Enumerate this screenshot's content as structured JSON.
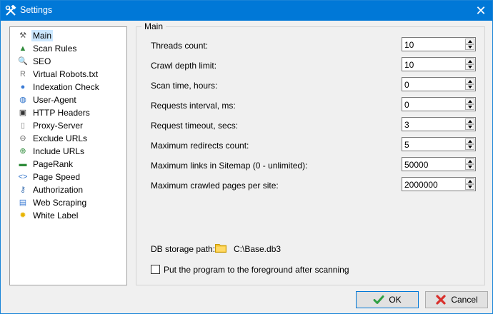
{
  "window": {
    "title": "Settings",
    "close_glyph": "✕"
  },
  "sidebar": {
    "items": [
      {
        "label": "Main",
        "icon": "tools-icon",
        "glyph": "⚒",
        "color": "#555555"
      },
      {
        "label": "Scan Rules",
        "icon": "scan-rules-icon",
        "glyph": "▲",
        "color": "#2e8b3a"
      },
      {
        "label": "SEO",
        "icon": "seo-magnifier-icon",
        "glyph": "🔍",
        "color": "#1a5fb4"
      },
      {
        "label": "Virtual Robots.txt",
        "icon": "robots-file-icon",
        "glyph": "R",
        "color": "#777777"
      },
      {
        "label": "Indexation Check",
        "icon": "indexation-icon",
        "glyph": "●",
        "color": "#3a7bd5"
      },
      {
        "label": "User-Agent",
        "icon": "globe-icon",
        "glyph": "◍",
        "color": "#2a6fc9"
      },
      {
        "label": "HTTP Headers",
        "icon": "monitor-icon",
        "glyph": "▣",
        "color": "#333333"
      },
      {
        "label": "Proxy-Server",
        "icon": "proxy-icon",
        "glyph": "▯",
        "color": "#888888"
      },
      {
        "label": "Exclude URLs",
        "icon": "exclude-link-icon",
        "glyph": "⊖",
        "color": "#666666"
      },
      {
        "label": "Include URLs",
        "icon": "include-link-icon",
        "glyph": "⊕",
        "color": "#2e8b3a"
      },
      {
        "label": "PageRank",
        "icon": "pagerank-icon",
        "glyph": "▬",
        "color": "#2e8b3a"
      },
      {
        "label": "Page Speed",
        "icon": "code-icon",
        "glyph": "<>",
        "color": "#2a6fc9"
      },
      {
        "label": "Authorization",
        "icon": "key-icon",
        "glyph": "⚷",
        "color": "#3a6fb0"
      },
      {
        "label": "Web Scraping",
        "icon": "web-scraping-icon",
        "glyph": "▤",
        "color": "#3a7bd5"
      },
      {
        "label": "White Label",
        "icon": "sun-icon",
        "glyph": "✹",
        "color": "#e8b400"
      }
    ]
  },
  "main": {
    "group_title": "Main",
    "fields": [
      {
        "label": "Threads count:",
        "value": "10"
      },
      {
        "label": "Crawl depth limit:",
        "value": "10"
      },
      {
        "label": "Scan time, hours:",
        "value": "0"
      },
      {
        "label": "Requests interval, ms:",
        "value": "0"
      },
      {
        "label": "Request timeout, secs:",
        "value": "3"
      },
      {
        "label": "Maximum redirects count:",
        "value": "5"
      },
      {
        "label": "Maximum links in Sitemap (0 - unlimited):",
        "value": "50000"
      },
      {
        "label": "Maximum crawled pages per site:",
        "value": "2000000"
      }
    ],
    "db_storage_label": "DB storage path:",
    "db_storage_path": "C:\\Base.db3",
    "foreground_checkbox_label": "Put the program to the foreground after scanning",
    "foreground_checked": false
  },
  "buttons": {
    "ok_label": "OK",
    "cancel_label": "Cancel"
  },
  "colors": {
    "titlebar": "#0078d7",
    "selection": "#cce8ff",
    "ok_check": "#2ea043",
    "cancel_x": "#d9302c",
    "folder": "#f4c430"
  }
}
